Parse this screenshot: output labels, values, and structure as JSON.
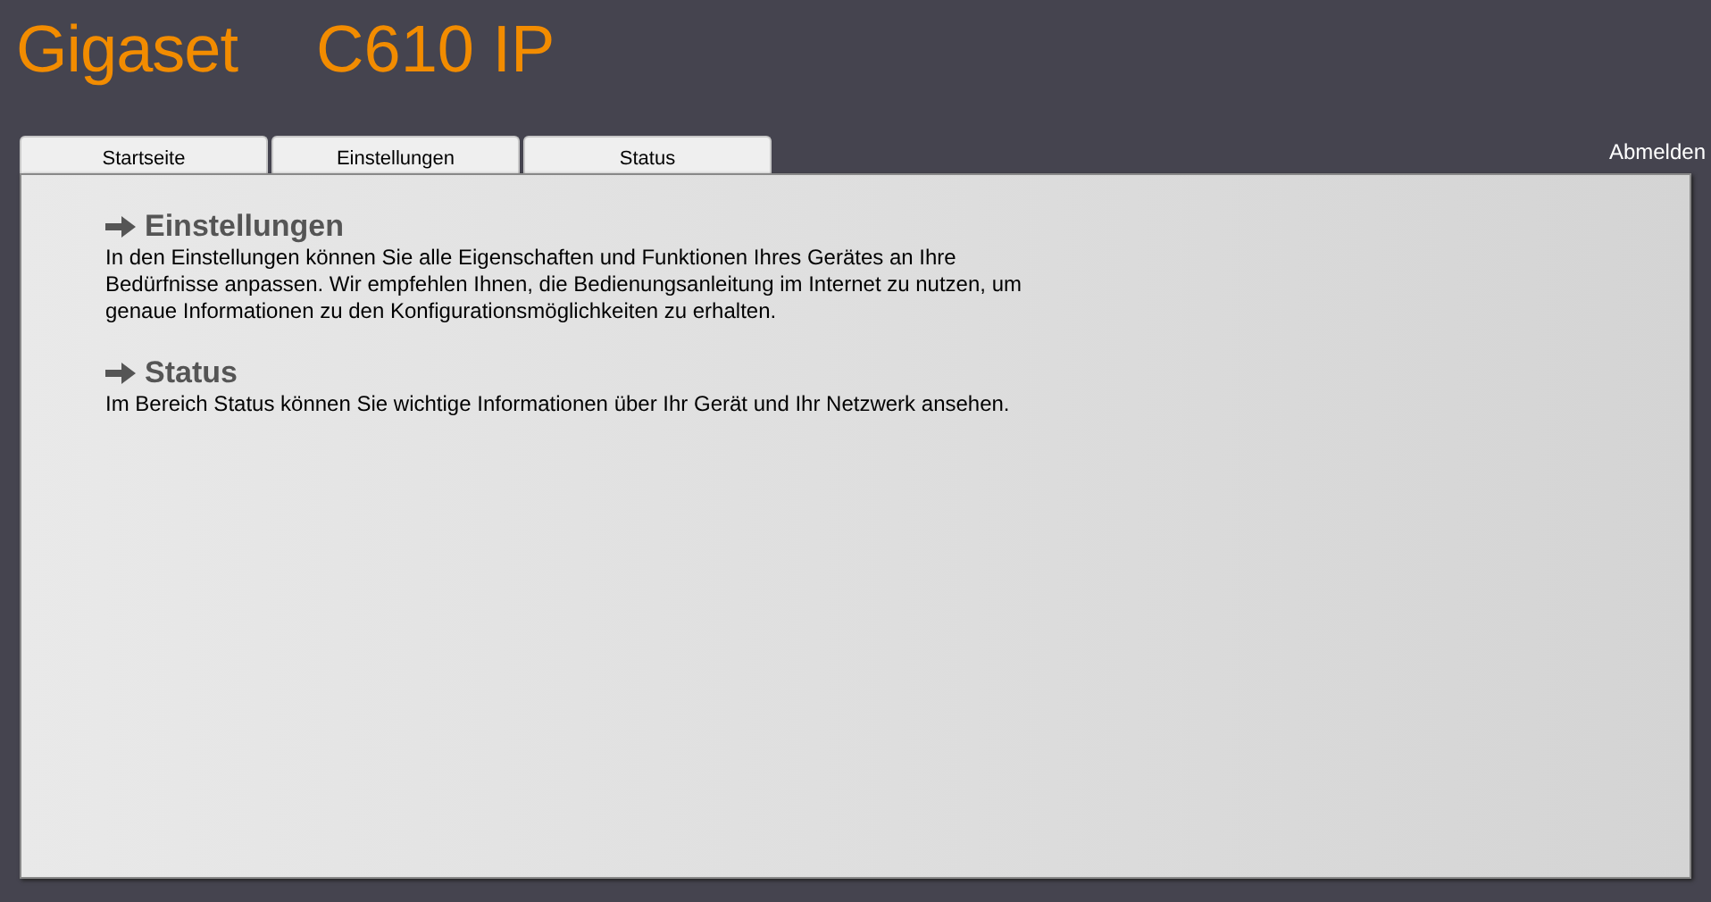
{
  "header": {
    "logo": "Gigaset",
    "model": "C610 IP"
  },
  "tabs": [
    {
      "label": "Startseite"
    },
    {
      "label": "Einstellungen"
    },
    {
      "label": "Status"
    }
  ],
  "logout": "Abmelden",
  "sections": [
    {
      "title": "Einstellungen",
      "text": "In den Einstellungen können Sie alle Eigenschaften und Funktionen Ihres Gerätes an Ihre Bedürfnisse anpassen. Wir empfehlen Ihnen, die Bedienungsanleitung im Internet zu nutzen, um genaue Informationen zu den Konfigurationsmöglichkeiten zu erhalten."
    },
    {
      "title": "Status",
      "text": "Im Bereich Status können Sie wichtige Informationen über Ihr Gerät und Ihr Netzwerk ansehen."
    }
  ]
}
